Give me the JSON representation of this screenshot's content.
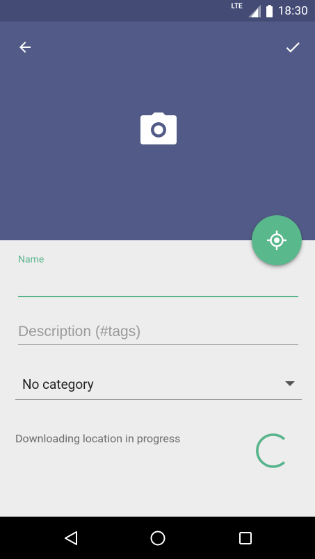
{
  "status_bar": {
    "network": "LTE",
    "time": "18:30"
  },
  "header": {
    "background_color": "#525b87",
    "back_icon": "arrow-left-icon",
    "confirm_icon": "check-icon",
    "camera_icon": "camera-icon"
  },
  "fab": {
    "icon": "crosshair-location-icon",
    "color": "#59b98c"
  },
  "form": {
    "name_label": "Name",
    "name_value": "",
    "description_placeholder": "Description (#tags)",
    "description_value": "",
    "category_selected": "No category",
    "progress_text": "Downloading location in progress",
    "accent_color": "#58b48c"
  },
  "nav_bar": {
    "back_icon": "triangle-back-icon",
    "home_icon": "circle-home-icon",
    "recents_icon": "square-recents-icon"
  }
}
